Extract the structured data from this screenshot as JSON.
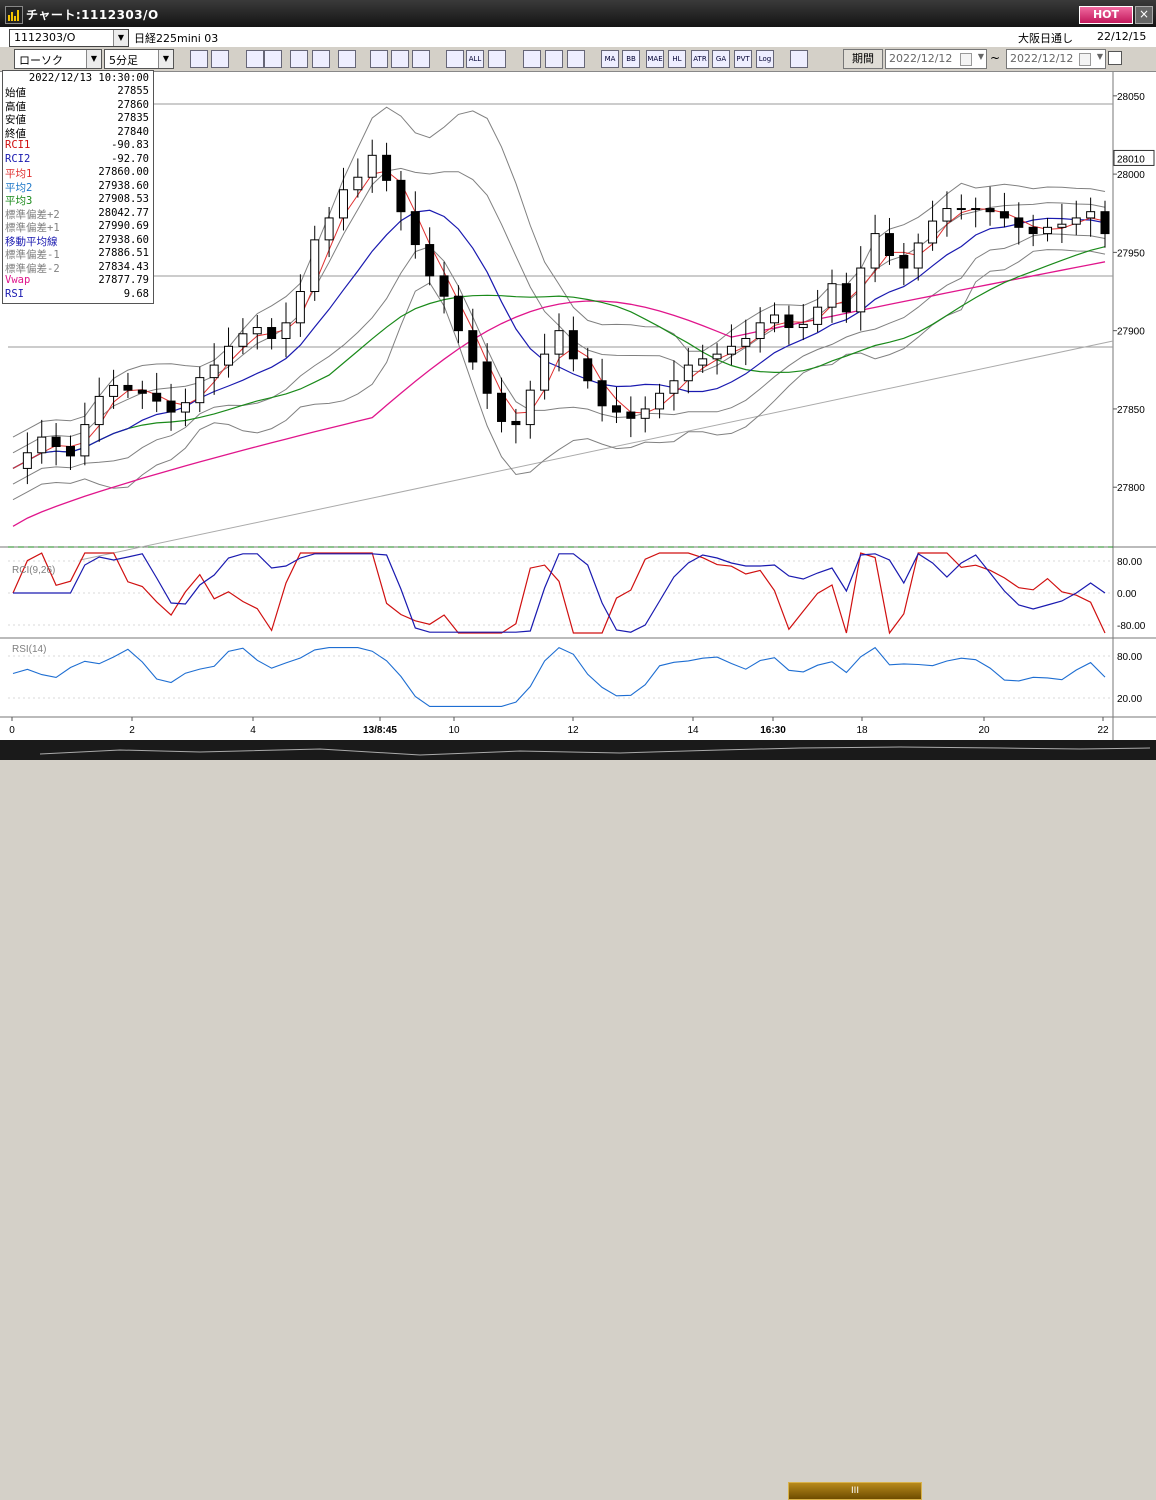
{
  "window": {
    "title": "チャート:1112303/O",
    "hot_label": "HOT",
    "close_label": "×"
  },
  "header": {
    "symbol_code": "1112303/O",
    "instrument_name": "日経225mini 03",
    "session": "大阪日通し",
    "date": "22/12/15"
  },
  "toolbar": {
    "chart_type": "ローソク",
    "interval": "5分足",
    "buttons": [
      "zoom",
      "hline",
      "buy",
      "sell",
      "trend",
      "fib",
      "arrow",
      "undo",
      "cross",
      "ma",
      "macd",
      "all",
      "eraser",
      "wrench",
      "palette",
      "sma",
      "ma2",
      "bb",
      "mae",
      "hl",
      "atr",
      "ga",
      "pvt",
      "log",
      "export"
    ],
    "button_labels": [
      "",
      "",
      "",
      "",
      "",
      "",
      "",
      "",
      "",
      "",
      "",
      "ALL",
      "",
      "",
      "",
      "",
      "MA",
      "BB",
      "MAE",
      "HL",
      "ATR",
      "GA",
      "PVT",
      "Log",
      ""
    ],
    "period_label": "期間",
    "date_from": "2022/12/12",
    "date_to": "2022/12/12",
    "tilde": "~"
  },
  "info_panel": {
    "datetime": "2022/12/13 10:30:00",
    "rows": [
      {
        "label": "始値",
        "value": "27855",
        "color": "#000000"
      },
      {
        "label": "高値",
        "value": "27860",
        "color": "#000000"
      },
      {
        "label": "安値",
        "value": "27835",
        "color": "#000000"
      },
      {
        "label": "終値",
        "value": "27840",
        "color": "#000000"
      },
      {
        "label": "RCI1",
        "value": "-90.83",
        "color": "#d01010"
      },
      {
        "label": "RCI2",
        "value": "-92.70",
        "color": "#1a1ab0"
      },
      {
        "label": "平均1",
        "value": "27860.00",
        "color": "#e03030"
      },
      {
        "label": "平均2",
        "value": "27938.60",
        "color": "#1e78c8"
      },
      {
        "label": "平均3",
        "value": "27908.53",
        "color": "#1a8a1a"
      },
      {
        "label": "標準偏差+2",
        "value": "28042.77",
        "color": "#808080"
      },
      {
        "label": "標準偏差+1",
        "value": "27990.69",
        "color": "#808080"
      },
      {
        "label": "移動平均線",
        "value": "27938.60",
        "color": "#1a1ab0"
      },
      {
        "label": "標準偏差-1",
        "value": "27886.51",
        "color": "#808080"
      },
      {
        "label": "標準偏差-2",
        "value": "27834.43",
        "color": "#808080"
      },
      {
        "label": "Vwap",
        "value": "27877.79",
        "color": "#e0168c"
      },
      {
        "label": "RSI",
        "value": "9.68",
        "color": "#1a1ab0"
      }
    ]
  },
  "price_axis": {
    "ticks": [
      "28050",
      "28000",
      "27950",
      "27900",
      "27850",
      "27800"
    ],
    "current_price": "28010"
  },
  "rci_panel": {
    "label": "RCI(9,26)",
    "ticks": [
      "80.00",
      "0.00",
      "-80.00"
    ]
  },
  "rsi_panel": {
    "label": "RSI(14)",
    "ticks": [
      "80.00",
      "20.00"
    ]
  },
  "time_axis": {
    "labels": [
      "0",
      "2",
      "4",
      "13/8:45",
      "10",
      "12",
      "14",
      "16:30",
      "18",
      "20",
      "22"
    ],
    "bold": [
      false,
      false,
      false,
      true,
      false,
      false,
      false,
      true,
      false,
      false,
      false
    ]
  },
  "colors": {
    "up_candle": "#ffffff",
    "down_candle": "#000000",
    "ma1": "#e03030",
    "ma2": "#1a1ab0",
    "ma3": "#1a8a1a",
    "bollinger": "#808080",
    "vwap": "#e0168c",
    "rci1": "#d01010",
    "rci2": "#1a1ab0",
    "rsi": "#1e6ed2"
  },
  "scrollbar": {
    "thumb_label": "III"
  },
  "chart_data": {
    "type": "candlestick",
    "x_range": [
      0,
      22
    ],
    "y_range": [
      27765,
      28055
    ],
    "closes": [
      27812,
      27822,
      27832,
      27826,
      27820,
      27840,
      27858,
      27865,
      27862,
      27860,
      27855,
      27848,
      27854,
      27870,
      27878,
      27890,
      27898,
      27902,
      27895,
      27905,
      27925,
      27958,
      27972,
      27990,
      27998,
      28012,
      27996,
      27976,
      27955,
      27935,
      27922,
      27900,
      27880,
      27860,
      27842,
      27840,
      27862,
      27885,
      27900,
      27882,
      27868,
      27852,
      27848,
      27844,
      27850,
      27860,
      27868,
      27878,
      27882,
      27885,
      27890,
      27895,
      27905,
      27910,
      27902,
      27904,
      27915,
      27930,
      27912,
      27940,
      27962,
      27948,
      27940,
      27956,
      27970,
      27978,
      27978,
      27978,
      27976,
      27972,
      27966,
      27962,
      27966,
      27968,
      27972,
      27976,
      27962
    ],
    "ma1_start": 27802,
    "ma1_end": 27962,
    "ma2_start": 27800,
    "ma2_end": 27960,
    "ma3_start": 27780,
    "ma3_end": 27944,
    "vwap_start": 27775,
    "vwap_end": 27944
  }
}
